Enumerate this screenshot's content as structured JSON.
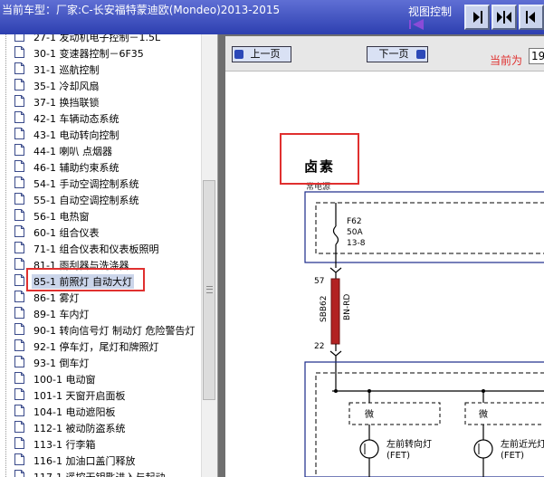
{
  "titlebar": {
    "model_label": "当前车型：厂家:C-长安福特蒙迪欧(Mondeo)2013-2015",
    "view_control_label": "视图控制"
  },
  "sidebar": {
    "items": [
      {
        "label": "27-1 发动机电子控制－1.5L"
      },
      {
        "label": "30-1 变速器控制－6F35"
      },
      {
        "label": "31-1 巡航控制"
      },
      {
        "label": "35-1 冷却风扇"
      },
      {
        "label": "37-1 换挡联锁"
      },
      {
        "label": "42-1 车辆动态系统"
      },
      {
        "label": "43-1 电动转向控制"
      },
      {
        "label": "44-1 喇叭 点烟器"
      },
      {
        "label": "46-1 辅助约束系统"
      },
      {
        "label": "54-1 手动空调控制系统"
      },
      {
        "label": "55-1 自动空调控制系统"
      },
      {
        "label": "56-1 电热窗"
      },
      {
        "label": "60-1 组合仪表"
      },
      {
        "label": "71-1 组合仪表和仪表板照明"
      },
      {
        "label": "81-1 雨刮器与洗涤器"
      },
      {
        "label": "85-1 前照灯 自动大灯",
        "selected": true
      },
      {
        "label": "86-1 雾灯"
      },
      {
        "label": "89-1 车内灯"
      },
      {
        "label": "90-1 转向信号灯 制动灯 危险警告灯"
      },
      {
        "label": "92-1 停车灯，尾灯和牌照灯"
      },
      {
        "label": "93-1 倒车灯"
      },
      {
        "label": "100-1 电动窗"
      },
      {
        "label": "101-1 天窗开启面板"
      },
      {
        "label": "104-1 电动遮阳板"
      },
      {
        "label": "112-1 被动防盗系统"
      },
      {
        "label": "113-1 行李箱"
      },
      {
        "label": "116-1 加油口盖门释放"
      },
      {
        "label": "117-1 遥控无钥匙进入与起动"
      }
    ]
  },
  "toolbar": {
    "prev_label": "上一页",
    "next_label": "下一页",
    "current_page_label": "当前为",
    "current_page_value": "19"
  },
  "diagram": {
    "heading": "卤素",
    "power_label": "常电源",
    "fuse_name": "F62",
    "fuse_rating": "50A",
    "fuse_location": "13-8",
    "pin_top": "57",
    "pin_bottom": "22",
    "splice": "SBB62",
    "wire_color": "BN-RD",
    "module_left": "微",
    "module_right": "微",
    "left_lamp": "左前转向灯",
    "right_lamp": "左前近光灯",
    "fet_left": "(FET)",
    "fet_right": "(FET)"
  },
  "colors": {
    "titlebar": "#3a4cc0",
    "highlight_box": "#e0302f",
    "wire": "#b22222",
    "diagram_border": "#1a2a8a"
  }
}
